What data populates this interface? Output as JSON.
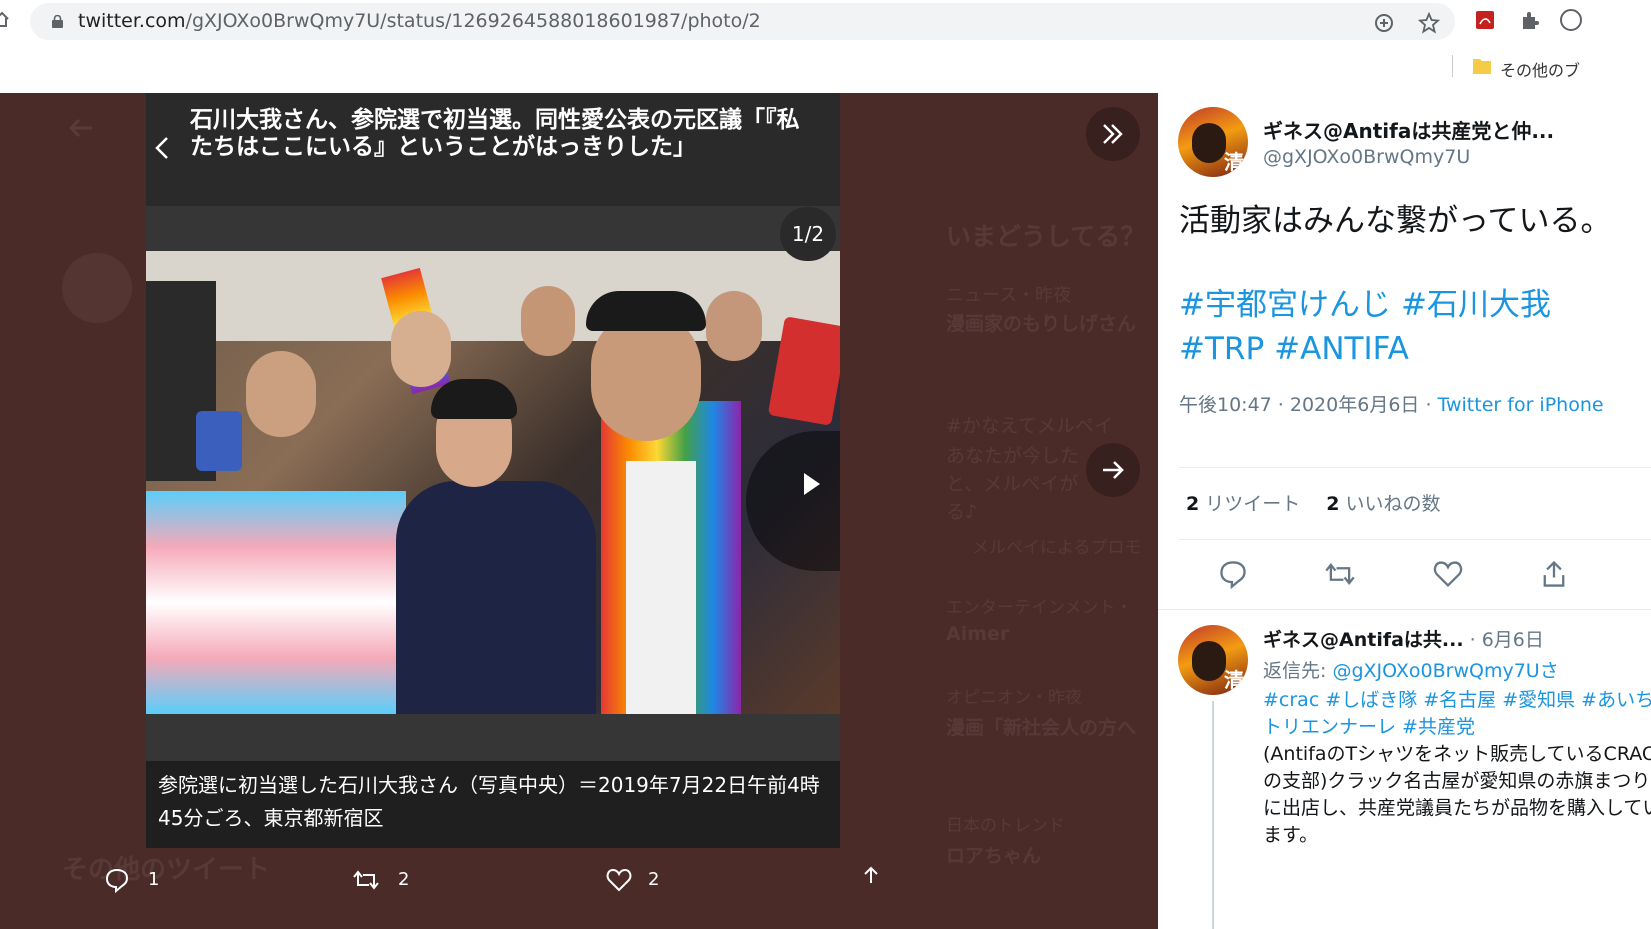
{
  "browser": {
    "url_host": "twitter.com",
    "url_path": "/gXJOXo0BrwQmy7U/status/1269264588018601987/photo/2",
    "bookmark_folder_label": "その他のブ"
  },
  "article": {
    "title": "石川大我さん、参院選で初当選。同性愛公表の元区議「『私たちはここにいる』ということがはっきりした」",
    "counter": "1/2",
    "caption": "参院選に初当選した石川大我さん（写真中央）＝2019年7月22日午前4時45分ごろ、東京都新宿区"
  },
  "background": {
    "trends_heading": "いまどうしてる？",
    "news_meta": "ニュース・昨夜",
    "news_title": "漫画家のもりしげさん",
    "promo_tag": "#かなえてメルペイ",
    "promo_line1": "あなたが今した",
    "promo_line2": "と、メルペイが",
    "promo_line3": "る♪",
    "promo_by": "メルペイによるプロモ",
    "ent_meta": "エンターテインメント・",
    "ent_title": "Aimer",
    "op_meta": "オピニオン・昨夜",
    "op_title": "漫画「新社会人の方へ",
    "jp_meta": "日本のトレンド",
    "jp_title": "ロアちゃん",
    "more_tweets": "その他のツイート",
    "reply_count": "1",
    "retweet_count": "2",
    "like_count": "2"
  },
  "tweet": {
    "author_name": "ギネス@Antifaは共産党と仲...",
    "author_handle": "@gXJOXo0BrwQmy7U",
    "avatar_glyph": "清",
    "text": "活動家はみんな繋がっている。",
    "hashtags": [
      "#宇都宮けんじ",
      "#石川大我",
      "#TRP",
      "#ANTIFA"
    ],
    "timestamp": "午後10:47 · 2020年6月6日 · ",
    "source": "Twitter for iPhone",
    "retweets_count": "2",
    "retweets_label": "リツイート",
    "likes_count": "2",
    "likes_label": "いいねの数"
  },
  "reply": {
    "author_name": "ギネス@Antifaは共...",
    "date": " · 6月6日",
    "replying_to_label": "返信先: ",
    "replying_to_handle": "@gXJOXo0BrwQmy7Uさ",
    "tags": "#crac #しばき隊 #名古屋 #愛知県 #あいちトリエンナーレ #共産党",
    "body": "(AntifaのTシャツをネット販売しているCRACの支部)クラック名古屋が愛知県の赤旗まつりに出店し、共産党議員たちが品物を購入しています。"
  },
  "colors": {
    "backdrop": "#4b2b28",
    "link": "#1b95e0",
    "text_dark": "#14171a",
    "text_muted": "#657786"
  }
}
